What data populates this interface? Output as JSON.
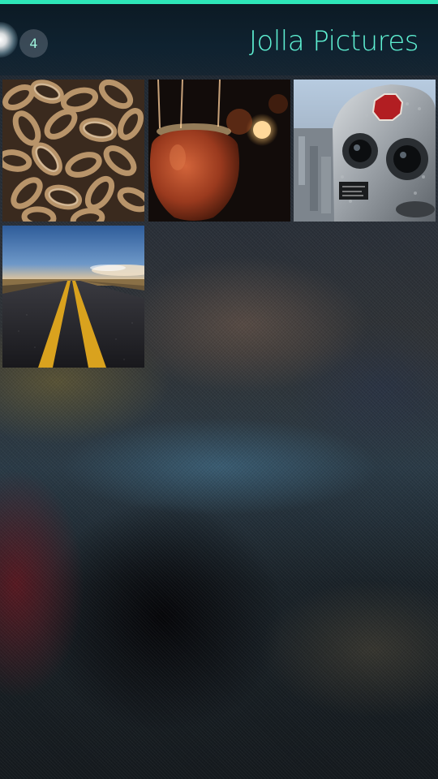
{
  "header": {
    "title": "Jolla Pictures",
    "count": "4"
  },
  "colors": {
    "accent": "#2ee6b8",
    "title_text": "#5ef0d2"
  },
  "gallery": {
    "items": [
      {
        "subject": "rusty chains"
      },
      {
        "subject": "hanging lantern pot with bokeh lights"
      },
      {
        "subject": "coin-operated tower viewer binoculars",
        "sign_text": "TURN TO CLEAR VISION"
      },
      {
        "subject": "open road with yellow center lines at sunset"
      }
    ]
  }
}
